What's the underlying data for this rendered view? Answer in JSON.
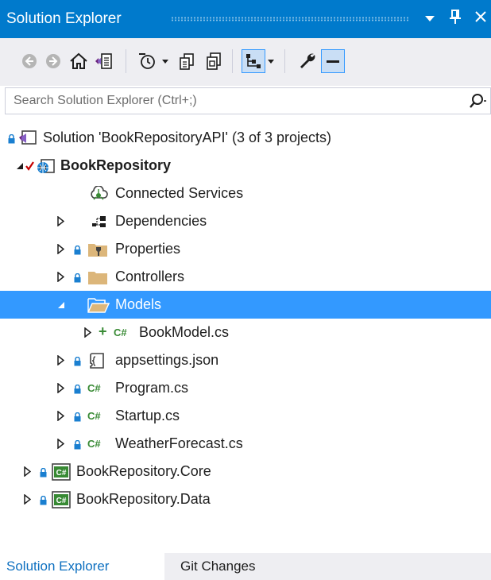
{
  "window": {
    "title": "Solution Explorer",
    "dropdown_glyph": "▾",
    "pin_glyph": "⊥",
    "close_glyph": "✕"
  },
  "toolbar": {
    "icons": [
      "back-icon",
      "forward-icon",
      "home-icon",
      "switch-views-icon",
      "pending-changes-filter-icon",
      "sync-active-document-icon",
      "collapse-all-icon",
      "show-all-files-icon",
      "preview-selected-items-icon",
      "properties-icon",
      "pin-preview-icon"
    ]
  },
  "search": {
    "placeholder": "Search Solution Explorer (Ctrl+;)"
  },
  "tree": {
    "solution": "Solution 'BookRepositoryAPI' (3 of 3 projects)",
    "project": "BookRepository",
    "connected_services": "Connected Services",
    "dependencies": "Dependencies",
    "properties": "Properties",
    "controllers": "Controllers",
    "models": "Models",
    "bookmodel": "BookModel.cs",
    "appsettings": "appsettings.json",
    "program": "Program.cs",
    "startup": "Startup.cs",
    "weatherforecast": "WeatherForecast.cs",
    "core": "BookRepository.Core",
    "data": "BookRepository.Data",
    "cs_badge": "C#",
    "add_badge": "+"
  },
  "tabs": {
    "solution_explorer": "Solution Explorer",
    "git_changes": "Git Changes"
  },
  "colors": {
    "accent": "#007acc",
    "selection": "#3399ff",
    "csharp_green": "#388a34",
    "folder": "#dcb67a",
    "lock": "#1a7fd0"
  }
}
